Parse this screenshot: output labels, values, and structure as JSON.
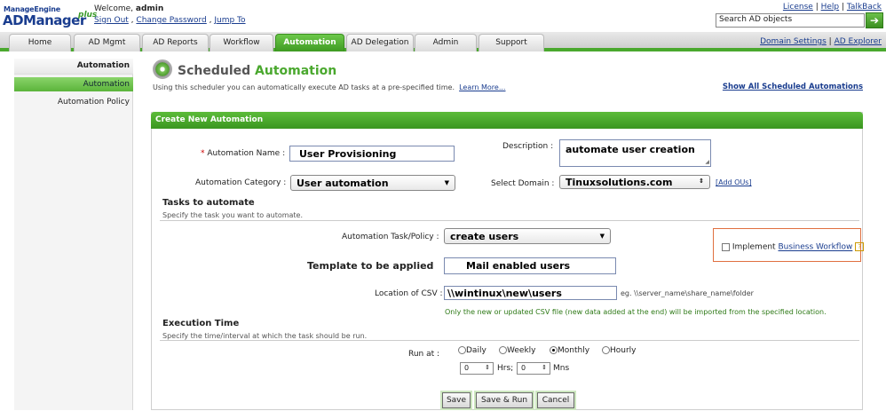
{
  "brand": {
    "top": "ManageEngine",
    "main": "ADManager",
    "plus": "plus"
  },
  "header": {
    "welcome_prefix": "Welcome,",
    "username": "admin",
    "sign_out": "Sign Out",
    "change_password": "Change Password",
    "jump_to": "Jump To",
    "links": {
      "license": "License",
      "help": "Help",
      "talkback": "TalkBack"
    },
    "search_value": "Search AD objects"
  },
  "nav": {
    "tabs": [
      "Home",
      "AD Mgmt",
      "AD Reports",
      "Workflow",
      "Automation",
      "AD Delegation",
      "Admin",
      "Support"
    ],
    "active": "Automation",
    "domain_settings": "Domain Settings",
    "ad_explorer": "AD Explorer"
  },
  "sidebar": {
    "heading": "Automation",
    "items": [
      "Automation",
      "Automation Policy"
    ]
  },
  "page": {
    "title_part1": "Scheduled",
    "title_part2": "Automation",
    "subtitle": "Using this scheduler you can automatically execute AD tasks at a pre-specified time.",
    "learn_more": "Learn More...",
    "show_all": "Show All Scheduled Automations"
  },
  "form": {
    "panel_title": "Create New Automation",
    "name_label": "Automation Name :",
    "name_value": "User Provisioning",
    "description_label": "Description :",
    "description_value": "automate user creation",
    "category_label": "Automation Category :",
    "category_value": "User automation",
    "domain_label": "Select Domain :",
    "domain_value": "Tinuxsolutions.com",
    "add_ous": "[Add OUs]",
    "tasks_heading": "Tasks to automate",
    "tasks_sub": "Specify the task you want to automate.",
    "task_label": "Automation Task/Policy :",
    "task_value": "create users",
    "implement_label": "Implement",
    "business_workflow": "Business Workflow",
    "help_glyph": "?",
    "template_label": "Template to be applied",
    "template_value": "Mail enabled users",
    "csv_label": "Location of CSV :",
    "csv_value": "\\\\wintinux\\new\\users",
    "csv_example": "eg. \\\\server_name\\share_name\\folder",
    "csv_note": "Only the new or updated CSV file (new data added at the end) will be imported from the specified location.",
    "exec_heading": "Execution Time",
    "exec_sub": "Specify the time/interval at which the task should be run.",
    "run_at_label": "Run at :",
    "run_options": [
      "Daily",
      "Weekly",
      "Monthly",
      "Hourly"
    ],
    "run_selected": "Monthly",
    "hrs_value": "0",
    "hrs_label": "Hrs;",
    "mns_value": "0",
    "mns_label": "Mns",
    "buttons": {
      "save": "Save",
      "save_run": "Save & Run",
      "cancel": "Cancel"
    }
  },
  "colors": {
    "accent_green": "#4aa82e",
    "link_blue": "#1a3d8f",
    "workflow_border": "#e07040"
  }
}
